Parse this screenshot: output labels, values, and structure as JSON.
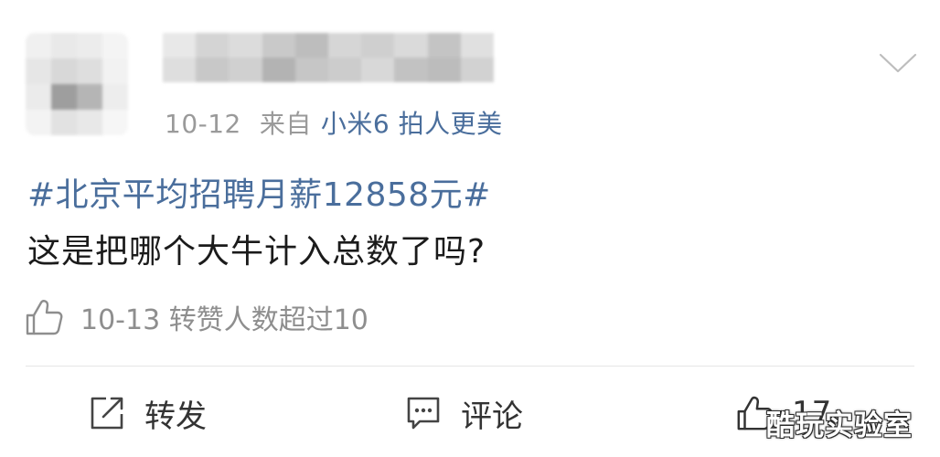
{
  "post": {
    "date": "10-12",
    "source_prefix": "来自",
    "device": "小米6 拍人更美",
    "hashtag": "#北京平均招聘月薪12858元#",
    "text": "这是把哪个大牛计入总数了吗?",
    "like_summary": "10-13 转赞人数超过10"
  },
  "actions": {
    "share_label": "转发",
    "comment_label": "评论",
    "like_count": "17"
  },
  "watermark": "酷玩实验室",
  "icons": {
    "menu": "chevron-down-icon",
    "like_summary": "thumbs-up-icon",
    "share": "share-icon",
    "comment": "comment-icon",
    "like": "thumbs-up-icon"
  },
  "colors": {
    "link_blue": "#4a6e9c",
    "text_dark": "#1b1b1b",
    "meta_gray": "#9a9a9a",
    "divider": "#e6e6e6"
  }
}
